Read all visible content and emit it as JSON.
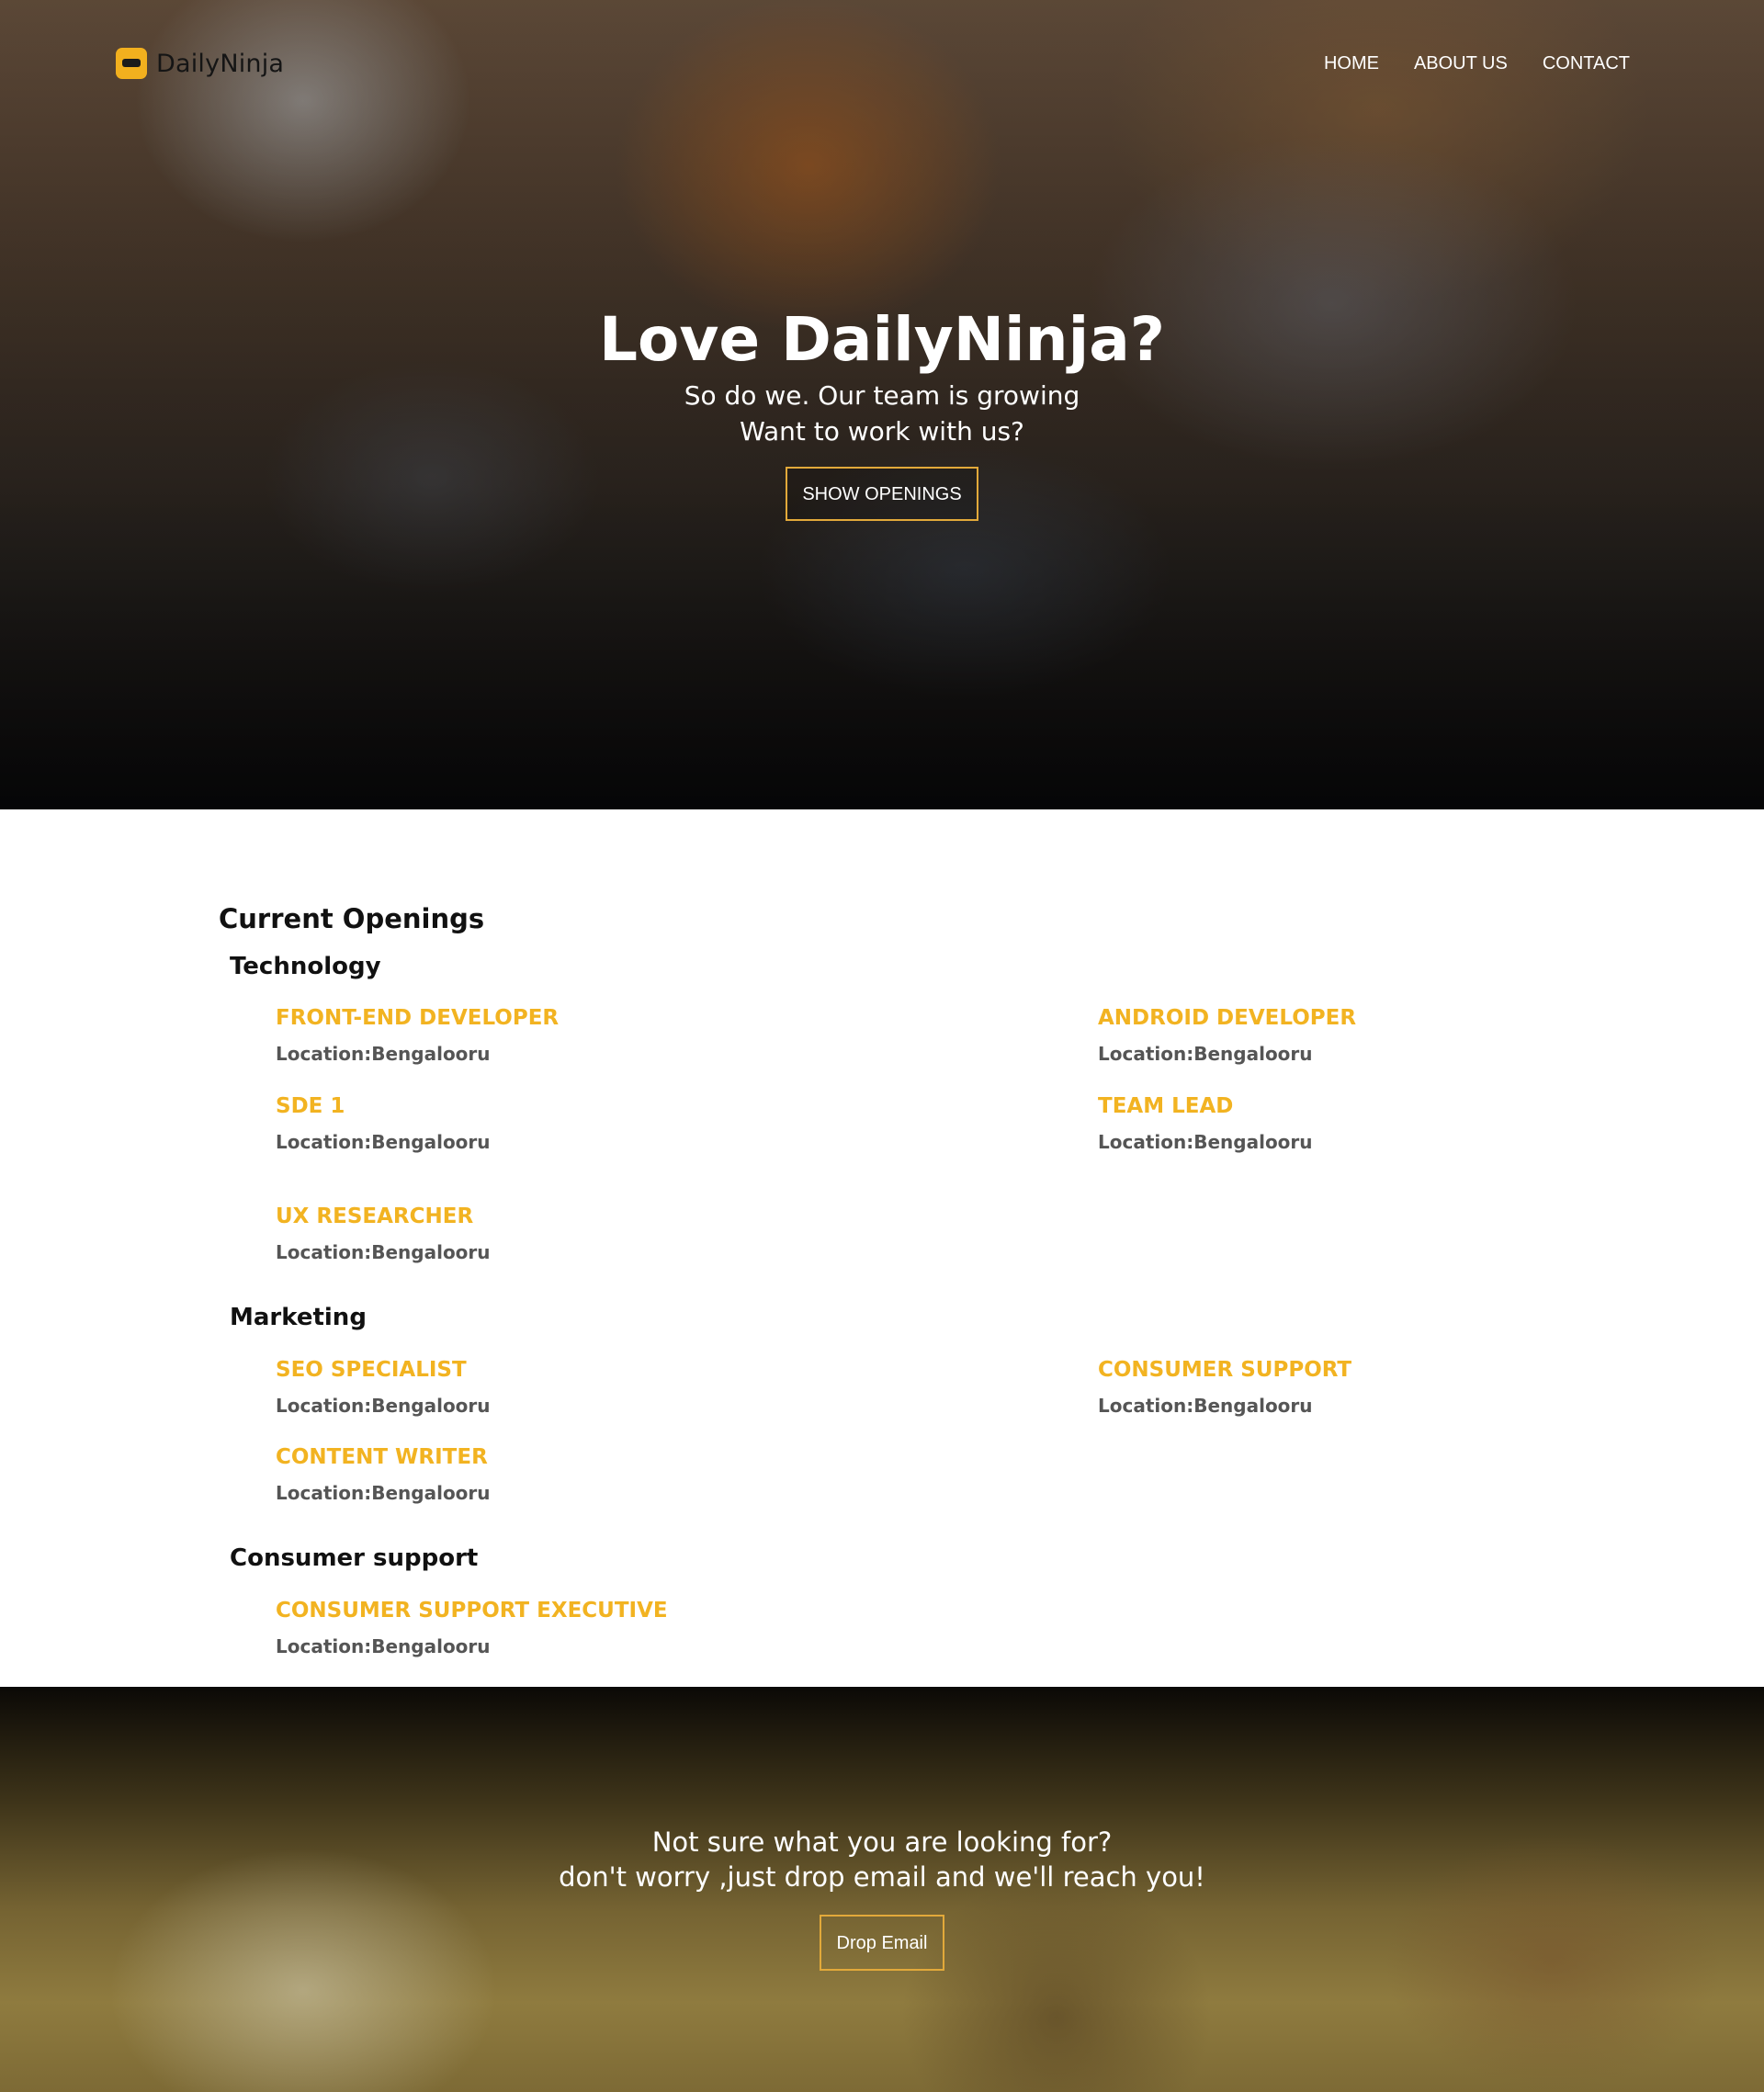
{
  "brand": {
    "name": "DailyNinja"
  },
  "nav": {
    "items": [
      "HOME",
      "ABOUT US",
      "CONTACT"
    ]
  },
  "hero": {
    "title": "Love DailyNinja?",
    "subtitle_line1": "So do we. Our team is growing",
    "subtitle_line2": "Want to work with us?",
    "button": "SHOW OPENINGS"
  },
  "openings": {
    "title": "Current Openings",
    "categories": [
      {
        "name": "Technology",
        "jobs": [
          {
            "title": "FRONT-END DEVELOPER",
            "location": "Location:Bengalooru"
          },
          {
            "title": "ANDROID DEVELOPER",
            "location": "Location:Bengalooru"
          },
          {
            "title": "SDE 1",
            "location": "Location:Bengalooru"
          },
          {
            "title": "TEAM LEAD",
            "location": "Location:Bengalooru"
          },
          {
            "title": "UX RESEARCHER",
            "location": "Location:Bengalooru"
          }
        ]
      },
      {
        "name": "Marketing",
        "jobs": [
          {
            "title": "SEO SPECIALIST",
            "location": "Location:Bengalooru"
          },
          {
            "title": "CONSUMER SUPPORT",
            "location": "Location:Bengalooru"
          },
          {
            "title": "CONTENT WRITER",
            "location": "Location:Bengalooru"
          }
        ]
      },
      {
        "name": "Consumer support",
        "jobs": [
          {
            "title": "CONSUMER SUPPORT EXECUTIVE",
            "location": "Location:Bengalooru"
          }
        ]
      }
    ]
  },
  "cta": {
    "line1": "Not sure what you are looking for?",
    "line2": "don't worry ,just drop email and we'll reach you!",
    "button": "Drop Email"
  },
  "colors": {
    "accent": "#f2b321",
    "button_border": "#e2a93a"
  },
  "icons": {
    "logo": "ninja-logo-icon"
  }
}
